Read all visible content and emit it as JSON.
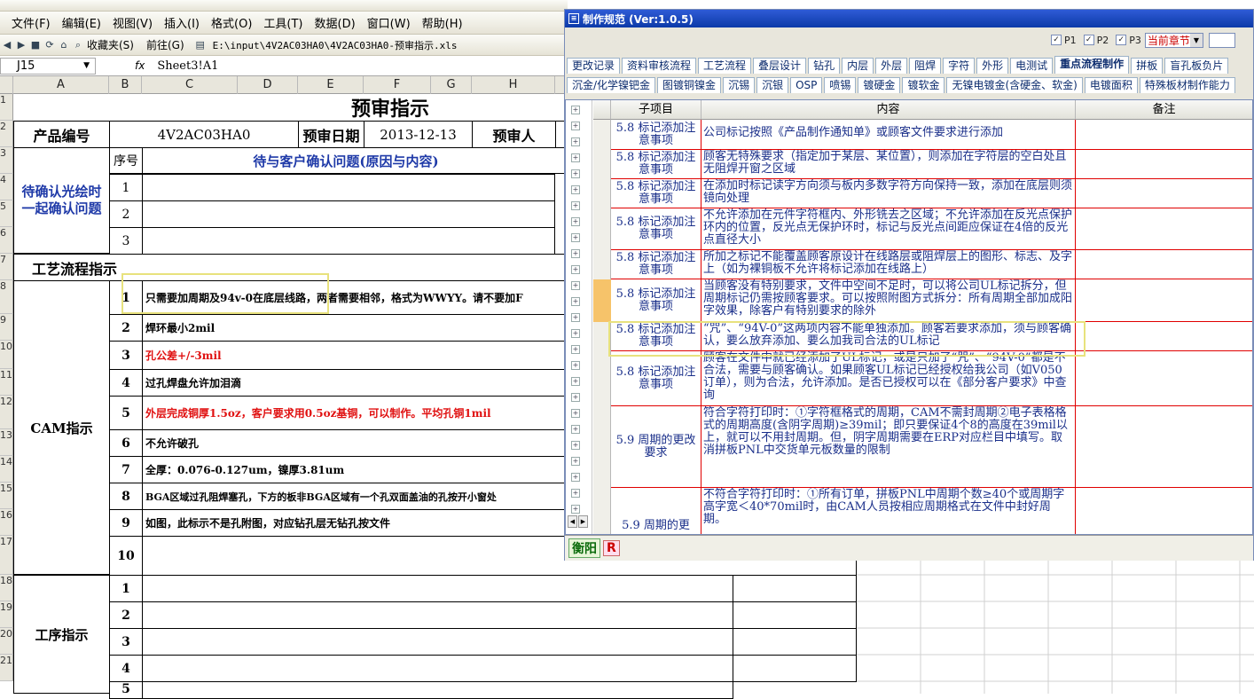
{
  "excel": {
    "menu": [
      "文件(F)",
      "编辑(E)",
      "视图(V)",
      "插入(I)",
      "格式(O)",
      "工具(T)",
      "数据(D)",
      "窗口(W)",
      "帮助(H)"
    ],
    "favorites": "收藏夹(S)",
    "goto": "前往(G)",
    "address": "E:\\input\\4V2AC03HA0\\4V2AC03HA0-预审指示.xls",
    "cell_ref": "J15",
    "formula_label": "fx",
    "formula": "Sheet3!A1",
    "columns": [
      "A",
      "B",
      "C",
      "D",
      "E",
      "F",
      "G",
      "H"
    ],
    "rows": [
      "1",
      "2",
      "3",
      "4",
      "5",
      "6",
      "7",
      "8",
      "9",
      "10",
      "11",
      "12",
      "13",
      "14",
      "15",
      "16",
      "17",
      "18",
      "19",
      "20",
      "21"
    ],
    "sheet": {
      "title": "预审指示",
      "product_no_label": "产品编号",
      "product_no": "4V2AC03HA0",
      "review_date_label": "预审日期",
      "review_date": "2013-12-13",
      "reviewer_label": "预审人",
      "confirm_label": "待确认光绘时一起确认问题",
      "seq_header": "序号",
      "confirm_header": "待与客户确认问题(原因与内容)",
      "confirm_nums": [
        "1",
        "2",
        "3"
      ],
      "flow_label": "工艺流程指示",
      "cam_label": "CAM指示",
      "cam_rows": [
        {
          "n": "1",
          "t": "只需要加周期及94v-0在底层线路，两者需要相邻，格式为WWYY。请不要加F",
          "red": false
        },
        {
          "n": "2",
          "t": "焊环最小2mil",
          "red": false
        },
        {
          "n": "3",
          "t": "孔公差+/-3mil",
          "red": true
        },
        {
          "n": "4",
          "t": "过孔焊盘允许加泪滴",
          "red": false
        },
        {
          "n": "5",
          "t": "外层完成铜厚1.5oz，客户要求用0.5oz基铜，可以制作。平均孔铜1mil",
          "red": true
        },
        {
          "n": "6",
          "t": "不允许破孔",
          "red": false
        },
        {
          "n": "7",
          "t": "全厚：0.076-0.127um，镍厚3.81um",
          "red": false
        },
        {
          "n": "8",
          "t": "BGA区域过孔阻焊塞孔，下方的板非BGA区域有一个孔双面盖油的孔按开小窗处",
          "red": false
        },
        {
          "n": "9",
          "t": "如图，此标示不是孔附图，对应钻孔层无钻孔按文件",
          "red": false
        },
        {
          "n": "10",
          "t": "",
          "red": false
        }
      ],
      "proc_label": "工序指示",
      "proc_nums": [
        "1",
        "2",
        "3",
        "4",
        "5"
      ]
    }
  },
  "pane": {
    "title": "制作规范 (Ver:1.0.5)",
    "checks": [
      "P1",
      "P2",
      "P3"
    ],
    "section_select": "当前章节",
    "tabs1": [
      "更改记录",
      "资料审核流程",
      "工艺流程",
      "叠层设计",
      "钻孔",
      "内层",
      "外层",
      "阻焊",
      "字符",
      "外形",
      "电测试",
      "重点流程制作",
      "拼板",
      "盲孔板负片"
    ],
    "tabs1_active": "重点流程制作",
    "tabs2": [
      "沉金/化学镍钯金",
      "图镀铜镍金",
      "沉锡",
      "沉银",
      "OSP",
      "喷锡",
      "镀硬金",
      "镀软金",
      "无镍电镀金(含硬金、软金)",
      "电镀面积",
      "特殊板材制作能力"
    ],
    "headers": [
      "子项目",
      "内容",
      "备注"
    ],
    "rows": [
      {
        "item": "5.8 标记添加注意事项",
        "content": "公司标记按照《产品制作通知单》或顾客文件要求进行添加"
      },
      {
        "item": "5.8 标记添加注意事项",
        "content": "顾客无特殊要求（指定加于某层、某位置），则添加在字符层的空白处且无阻焊开窗之区域"
      },
      {
        "item": "5.8 标记添加注意事项",
        "content": "在添加时标记读字方向须与板内多数字符方向保持一致，添加在底层则须镜向处理"
      },
      {
        "item": "5.8 标记添加注意事项",
        "content": "不允许添加在元件字符框内、外形铣去之区域；不允许添加在反光点保护环内的位置，反光点无保护环时，标记与反光点间距应保证在4倍的反光点直径大小"
      },
      {
        "item": "5.8 标记添加注意事项",
        "content": "所加之标记不能覆盖顾客原设计在线路层或阻焊层上的图形、标志、及字上（如为裸铜板不允许将标记添加在线路上）"
      },
      {
        "item": "5.8 标记添加注意事项",
        "content": "当顾客没有特别要求，文件中空间不足时，可以将公司UL标记拆分，但周期标记仍需按顾客要求。可以按照附图方式拆分：所有周期全部加成阳字效果，除客户有特别要求的除外"
      },
      {
        "item": "5.8 标记添加注意事项",
        "content": "“咒”、“94V-0”这两项内容不能单独添加。顾客若要求添加，须与顾客确认，要么放弃添加、要么加我司合法的UL标记"
      },
      {
        "item": "5.8 标记添加注意事项",
        "content": "顾客在文件中就已经添加了UL标记，或是只加了“咒”、“94V-0”都是不合法，需要与顾客确认。如果顾客UL标记已经授权给我公司（如V050订单），则为合法，允许添加。是否已授权可以在《部分客户要求》中查询"
      },
      {
        "item": "5.9 周期的更改要求",
        "content": "符合字符打印时：①字符框格式的周期，CAM不需封周期②电子表格格式的周期高度(含阴字周期)≥39mil；即只要保证4个8的高度在39mil以上，就可以不用封周期。但，阴字周期需要在ERP对应栏目中填写。取消拼板PNL中交货单元板数量的限制"
      },
      {
        "item": "5.9 周期的更",
        "content": "不符合字符打印时：①所有订单，拼板PNL中周期个数≥40个或周期字高字宽＜40*70mil时，由CAM人员按相应周期格式在文件中封好周期。"
      }
    ],
    "sheet_tabs": [
      "衡阳",
      "R"
    ]
  },
  "colors": {
    "accent": "#0c3aa8",
    "highlight": "#e8e27d",
    "grid_red": "#e00000",
    "navy_text": "#1f3aa8"
  }
}
